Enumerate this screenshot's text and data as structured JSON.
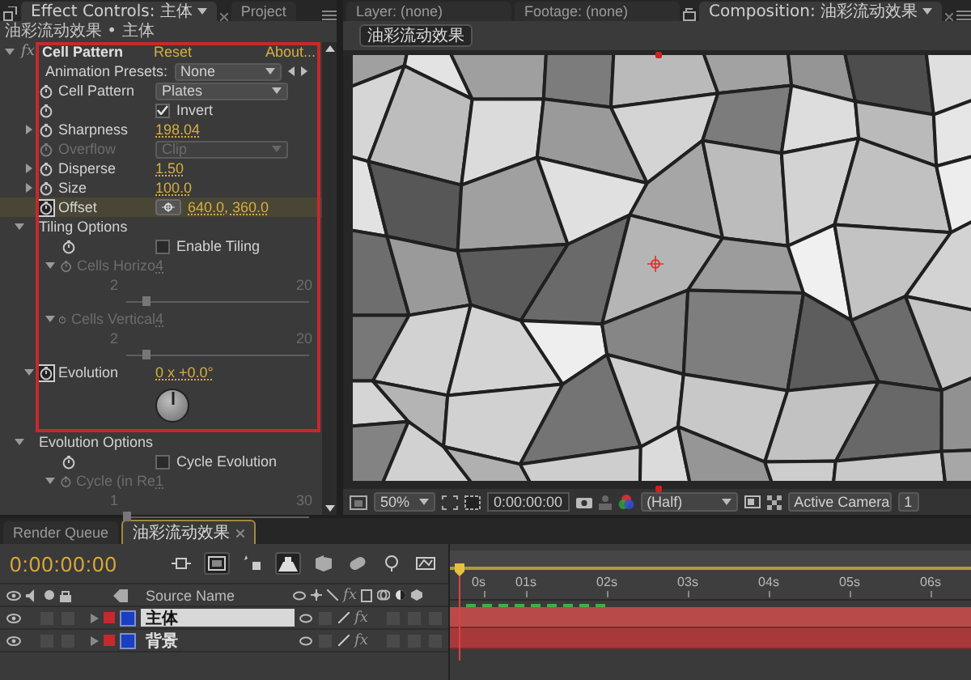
{
  "effect_panel": {
    "tabs": [
      {
        "label": "Effect Controls: 主体",
        "selected": true
      },
      {
        "label": "Project",
        "selected": false
      }
    ],
    "breadcrumb": "油彩流动效果 • 主体",
    "effect": {
      "badge": "fx",
      "expanded": true,
      "name": "Cell Pattern",
      "reset": "Reset",
      "about": "About...",
      "framed_rows": [
        {
          "kind": "preset",
          "label": "Animation Presets:",
          "value": "None"
        },
        {
          "kind": "dropdown",
          "label": "Cell Pattern",
          "animated": false,
          "value": "Plates",
          "disabled": false
        },
        {
          "kind": "checkbox",
          "animated": false,
          "text": "Invert",
          "checked": true
        },
        {
          "kind": "value",
          "label": "Sharpness",
          "animated": false,
          "expanded": false,
          "value": "198.04",
          "disabled": false
        },
        {
          "kind": "dropdown",
          "label": "Overflow",
          "animated": false,
          "value": "Clip",
          "disabled": true
        },
        {
          "kind": "value",
          "label": "Disperse",
          "animated": false,
          "expanded": false,
          "value": "1.50",
          "disabled": false
        },
        {
          "kind": "value",
          "label": "Size",
          "animated": false,
          "expanded": false,
          "value": "100.0",
          "disabled": false
        },
        {
          "kind": "point",
          "label": "Offset",
          "animated": true,
          "value": "640.0, 360.0"
        },
        {
          "kind": "group",
          "label": "Tiling Options",
          "expanded": true,
          "children": [
            {
              "kind": "checkbox",
              "animated": false,
              "text": "Enable Tiling",
              "checked": false
            },
            {
              "kind": "slider",
              "label": "Cells Horizo",
              "animated": false,
              "expanded": true,
              "value": "4",
              "min": "2",
              "max": "20",
              "level": 0.11,
              "disabled": true
            },
            {
              "kind": "slider",
              "label": "Cells Vertical",
              "animated": false,
              "expanded": true,
              "value": "4",
              "min": "2",
              "max": "20",
              "level": 0.11,
              "disabled": true
            }
          ]
        },
        {
          "kind": "angle",
          "label": "Evolution",
          "animated": true,
          "expanded": true,
          "value": "0 x +0.0°"
        }
      ],
      "rows": [
        {
          "kind": "group",
          "label": "Evolution Options",
          "expanded": true,
          "children": [
            {
              "kind": "checkbox",
              "animated": false,
              "text": "Cycle Evolution",
              "checked": false
            },
            {
              "kind": "slider",
              "label": "Cycle (in Re",
              "animated": false,
              "expanded": true,
              "value": "1",
              "min": "1",
              "max": "30",
              "level": 0,
              "disabled": true
            }
          ]
        }
      ]
    }
  },
  "composition_panel": {
    "tabs": [
      {
        "label": "Layer: (none)",
        "selected": false
      },
      {
        "label": "Footage: (none)",
        "selected": false
      },
      {
        "label": "Composition: 油彩流动效果",
        "selected": true
      }
    ],
    "comp_button": "油彩流动效果",
    "toolbar": {
      "zoom": "50%",
      "timecode": "0:00:00:00",
      "resolution": "(Half)",
      "view": "Active Camera",
      "views": "1"
    }
  },
  "timeline": {
    "tabs": [
      {
        "label": "Render Queue",
        "selected": false
      },
      {
        "label": "油彩流动效果",
        "selected": true
      }
    ],
    "timecode": "0:00:00:00",
    "source_name": "Source Name",
    "effects_switch": "fx",
    "layers": [
      {
        "name": "主体",
        "selected": true,
        "fx": "fx",
        "effects_on": true
      },
      {
        "name": "背景",
        "selected": false,
        "fx": "fx",
        "effects_on": true
      }
    ],
    "ruler": [
      "0s",
      "01s",
      "02s",
      "03s",
      "04s",
      "05s",
      "06s"
    ]
  }
}
